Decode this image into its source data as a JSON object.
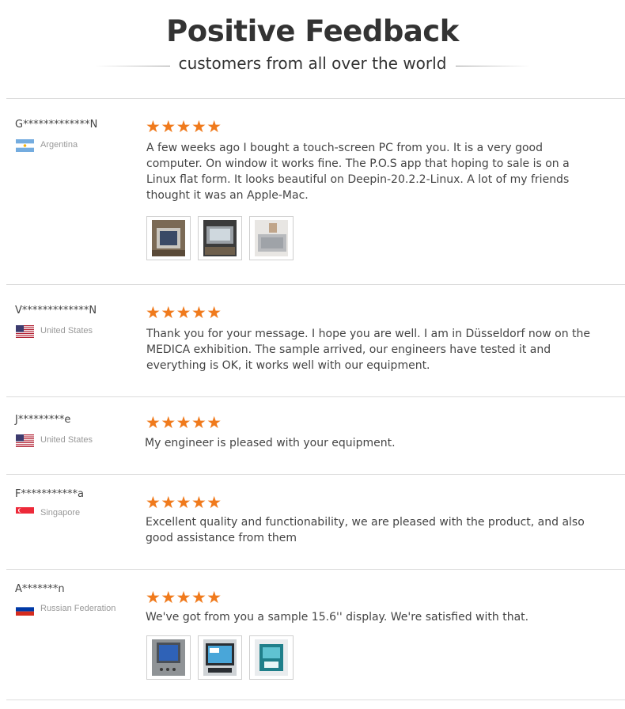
{
  "header": {
    "title": "Positive Feedback",
    "subtitle": "customers from all over the world"
  },
  "colors": {
    "star": "#f07a1c",
    "text": "#444444",
    "muted": "#999999",
    "divider": "#dcdcdc"
  },
  "reviews": [
    {
      "name": "G*************N",
      "country": "Argentina",
      "flag_icon": "argentina-flag-icon",
      "rating": 5,
      "stars": "★★★★★",
      "text": "A few weeks ago I bought a touch-screen PC from you. It is a very good computer. On window it works fine. The P.O.S app that hoping to sale is on a Linux flat form. It looks beautiful on Deepin-20.2.2-Linux. A lot of my friends thought it was an Apple-Mac.",
      "photos": [
        "photo-thumbnail",
        "photo-thumbnail",
        "photo-thumbnail"
      ]
    },
    {
      "name": "V*************N",
      "country": "United States",
      "flag_icon": "united-states-flag-icon",
      "rating": 5,
      "stars": "★★★★★",
      "text": "Thank you for your message. I hope you are well. I am in Düsseldorf now on the MEDICA exhibition. The sample arrived, our engineers have tested it and everything is OK, it works well with our equipment.",
      "photos": []
    },
    {
      "name": "J*********e",
      "country": "United States",
      "flag_icon": "united-states-flag-icon",
      "rating": 5,
      "stars": "★★★★★",
      "text": "My engineer is pleased with your equipment.",
      "photos": []
    },
    {
      "name": "F***********a",
      "country": "Singapore",
      "flag_icon": "singapore-flag-icon",
      "rating": 5,
      "stars": "★★★★★",
      "text": "Excellent quality and functionability, we are pleased with the product, and also good assistance from them",
      "photos": []
    },
    {
      "name": "A*******n",
      "country": "Russian Federation",
      "flag_icon": "russia-flag-icon",
      "rating": 5,
      "stars": "★★★★★",
      "text": "We've got from you a sample 15.6'' display. We're satisfied with that.",
      "photos": [
        "photo-thumbnail",
        "photo-thumbnail",
        "photo-thumbnail"
      ]
    }
  ]
}
